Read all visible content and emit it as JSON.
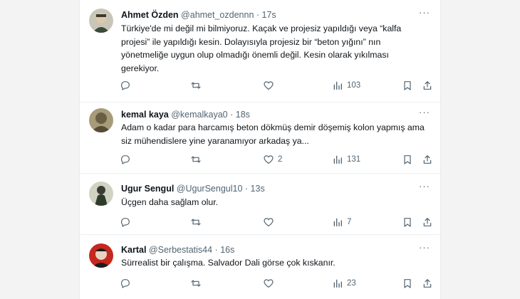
{
  "tweets": [
    {
      "name": "Ahmet Özden",
      "handle": "@ahmet_ozdennn",
      "dot": "·",
      "time": "17s",
      "text": "Türkiye'de mi değil mi bilmiyoruz. Kaçak ve projesiz yapıldığı veya “kalfa projesi” ile yapıldığı kesin. Dolayısıyla projesiz bir “beton yığını” nın yönetmeliğe uygun olup olmadığı önemli değil. Kesin olarak yıkılması gerekiyor.",
      "likes": "",
      "views": "103",
      "avatar_color": "#6f7a5a"
    },
    {
      "name": "kemal kaya",
      "handle": "@kemalkaya0",
      "dot": "·",
      "time": "18s",
      "text": "Adam o kadar para harcamış beton dökmüş demir döşemiş kolon yapmış ama siz mühendislere yine yaranamıyor arkadaş ya...",
      "likes": "2",
      "views": "131",
      "avatar_color": "#8a7f5c"
    },
    {
      "name": "Ugur Sengul",
      "handle": "@UgurSengul10",
      "dot": "·",
      "time": "13s",
      "text": "Üçgen daha sağlam olur.",
      "likes": "",
      "views": "7",
      "avatar_color": "#7d8a6e"
    },
    {
      "name": "Kartal",
      "handle": "@Serbestatis44",
      "dot": "·",
      "time": "16s",
      "text": "Sürrealist bir çalışma. Salvador Dali görse çok kıskanır.",
      "likes": "",
      "views": "23",
      "avatar_color": "#b3241c"
    }
  ],
  "more_glyph": "···",
  "colors": {
    "icon": "#536471",
    "text": "#0f1419",
    "divider": "#eceef0"
  }
}
